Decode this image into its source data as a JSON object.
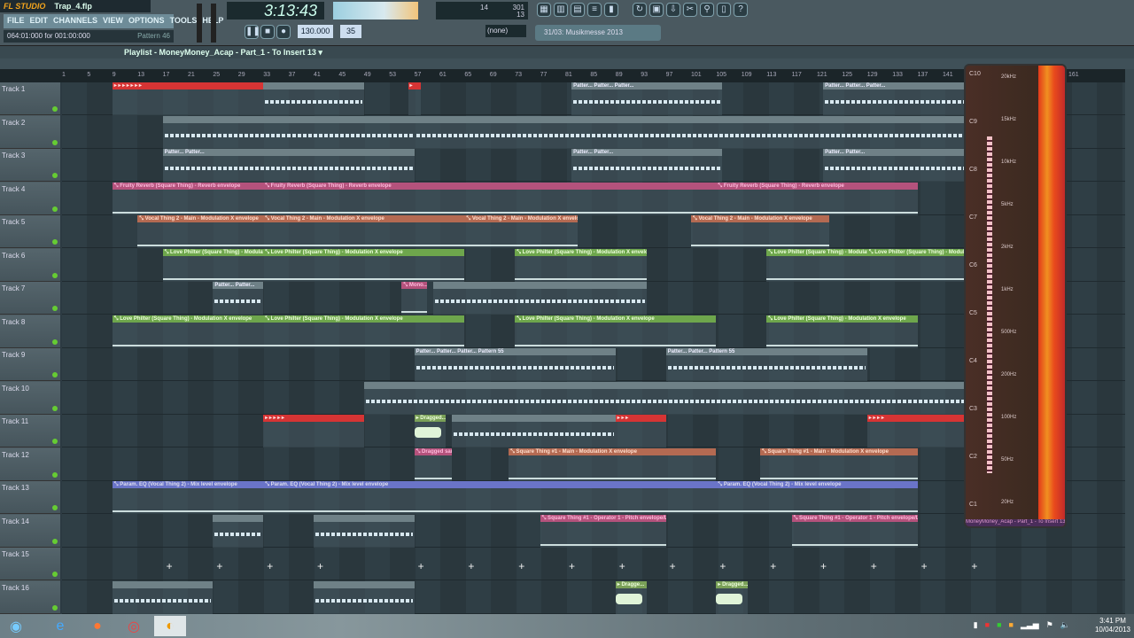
{
  "app": {
    "logo": "FL STUDIO",
    "file": "Trap_4.flp"
  },
  "menu": [
    "FILE",
    "EDIT",
    "CHANNELS",
    "VIEW",
    "OPTIONS",
    "TOOLS",
    "HELP"
  ],
  "hint": {
    "text": "064:01:000 for 001:00:000",
    "pattern": "Pattern 46"
  },
  "transport": {
    "time": "3:13:43",
    "tempo": "130.000",
    "pattern_num": "35",
    "cpu": "14",
    "mem": "301",
    "poly": "13",
    "buttons": [
      "pause",
      "stop",
      "record"
    ]
  },
  "snap": "(none)",
  "news": "31/03: Musikmesse 2013",
  "toolbar_icons": [
    "playlist",
    "step-sequencer",
    "piano-roll",
    "browser",
    "mixer"
  ],
  "toolbar_icons2": [
    "undo",
    "save",
    "export",
    "cut",
    "search",
    "project-info",
    "help"
  ],
  "playlist": {
    "title": "Playlist - MoneyMoney_Acap - Part_1 - To Insert 13 ▾"
  },
  "ruler": {
    "start": 1,
    "step": 4,
    "end": 161
  },
  "tracks": [
    "Track 1",
    "Track 2",
    "Track 3",
    "Track 4",
    "Track 5",
    "Track 6",
    "Track 7",
    "Track 8",
    "Track 9",
    "Track 10",
    "Track 11",
    "Track 12",
    "Track 13",
    "Track 14",
    "Track 15",
    "Track 16"
  ],
  "clips": [
    {
      "t": 0,
      "s": 9,
      "l": 24,
      "type": "red",
      "label": "▸ ▸ ▸ ▸ ▸ ▸ ▸"
    },
    {
      "t": 0,
      "s": 33,
      "l": 16,
      "type": "pat",
      "label": ""
    },
    {
      "t": 0,
      "s": 56,
      "l": 2,
      "type": "red",
      "label": "▸"
    },
    {
      "t": 0,
      "s": 82,
      "l": 24,
      "type": "pat",
      "label": "Patter... Patter... Patter..."
    },
    {
      "t": 0,
      "s": 122,
      "l": 24,
      "type": "pat",
      "label": "Patter... Patter... Patter..."
    },
    {
      "t": 1,
      "s": 17,
      "l": 40,
      "type": "pat",
      "label": ""
    },
    {
      "t": 1,
      "s": 57,
      "l": 88,
      "type": "pat",
      "label": ""
    },
    {
      "t": 2,
      "s": 17,
      "l": 40,
      "type": "pat",
      "label": "Patter... Patter..."
    },
    {
      "t": 2,
      "s": 82,
      "l": 24,
      "type": "pat",
      "label": "Patter... Patter..."
    },
    {
      "t": 2,
      "s": 122,
      "l": 24,
      "type": "pat",
      "label": "Patter... Patter..."
    },
    {
      "t": 3,
      "s": 9,
      "l": 24,
      "type": "pink",
      "label": "⤡ Fruity Reverb (Square Thing) - Reverb envelope"
    },
    {
      "t": 3,
      "s": 33,
      "l": 72,
      "type": "pink",
      "label": "⤡ Fruity Reverb (Square Thing) - Reverb envelope"
    },
    {
      "t": 3,
      "s": 105,
      "l": 32,
      "type": "pink",
      "label": "⤡ Fruity Reverb (Square Thing) - Reverb envelope"
    },
    {
      "t": 4,
      "s": 13,
      "l": 20,
      "type": "orange",
      "label": "⤡ Vocal Thing 2 - Main - Modulation X envelope"
    },
    {
      "t": 4,
      "s": 33,
      "l": 32,
      "type": "orange",
      "label": "⤡ Vocal Thing 2 - Main - Modulation X envelope"
    },
    {
      "t": 4,
      "s": 65,
      "l": 18,
      "type": "orange",
      "label": "⤡ Vocal Thing 2 - Main - Modulation X envelope"
    },
    {
      "t": 4,
      "s": 101,
      "l": 22,
      "type": "orange",
      "label": "⤡ Vocal Thing 2 - Main - Modulation X envelope"
    },
    {
      "t": 5,
      "s": 17,
      "l": 16,
      "type": "green",
      "label": "⤡ Love Philter (Square Thing) - Modulation..."
    },
    {
      "t": 5,
      "s": 33,
      "l": 32,
      "type": "green",
      "label": "⤡ Love Philter (Square Thing) - Modulation X envelope"
    },
    {
      "t": 5,
      "s": 73,
      "l": 21,
      "type": "green",
      "label": "⤡ Love Philter (Square Thing) - Modulation X envelope"
    },
    {
      "t": 5,
      "s": 113,
      "l": 16,
      "type": "green",
      "label": "⤡ Love Philter (Square Thing) - Modulation..."
    },
    {
      "t": 5,
      "s": 129,
      "l": 16,
      "type": "green",
      "label": "⤡ Love Philter (Square Thing) - Modulation..."
    },
    {
      "t": 6,
      "s": 25,
      "l": 8,
      "type": "pat",
      "label": "Patter... Patter..."
    },
    {
      "t": 6,
      "s": 55,
      "l": 4,
      "type": "pink",
      "label": "⤡ Mono..."
    },
    {
      "t": 6,
      "s": 60,
      "l": 34,
      "type": "pat",
      "label": ""
    },
    {
      "t": 7,
      "s": 9,
      "l": 24,
      "type": "green",
      "label": "⤡ Love Philter (Square Thing) - Modulation X envelope"
    },
    {
      "t": 7,
      "s": 33,
      "l": 32,
      "type": "green",
      "label": "⤡ Love Philter (Square Thing) - Modulation X envelope"
    },
    {
      "t": 7,
      "s": 73,
      "l": 32,
      "type": "green",
      "label": "⤡ Love Philter (Square Thing) - Modulation X envelope"
    },
    {
      "t": 7,
      "s": 113,
      "l": 24,
      "type": "green",
      "label": "⤡ Love Philter (Square Thing) - Modulation X envelope"
    },
    {
      "t": 8,
      "s": 57,
      "l": 32,
      "type": "pat",
      "label": "Patter... Patter... Patter... Pattern 55"
    },
    {
      "t": 8,
      "s": 97,
      "l": 32,
      "type": "pat",
      "label": "Patter... Patter... Pattern 55"
    },
    {
      "t": 9,
      "s": 49,
      "l": 96,
      "type": "pat",
      "label": ""
    },
    {
      "t": 10,
      "s": 33,
      "l": 16,
      "type": "red",
      "label": "▸ ▸ ▸ ▸ ▸"
    },
    {
      "t": 10,
      "s": 57,
      "l": 5,
      "type": "sample",
      "label": "▸ Dragged..."
    },
    {
      "t": 10,
      "s": 63,
      "l": 26,
      "type": "pat",
      "label": ""
    },
    {
      "t": 10,
      "s": 89,
      "l": 8,
      "type": "red",
      "label": "▸ ▸ ▸"
    },
    {
      "t": 10,
      "s": 129,
      "l": 16,
      "type": "red",
      "label": "▸ ▸ ▸ ▸"
    },
    {
      "t": 11,
      "s": 57,
      "l": 6,
      "type": "pink",
      "label": "⤡ Dragged sam..."
    },
    {
      "t": 11,
      "s": 72,
      "l": 33,
      "type": "orange",
      "label": "⤡ Square Thing #1 - Main - Modulation X envelope"
    },
    {
      "t": 11,
      "s": 112,
      "l": 25,
      "type": "orange",
      "label": "⤡ Square Thing #1 - Main - Modulation X envelope"
    },
    {
      "t": 12,
      "s": 9,
      "l": 24,
      "type": "blue",
      "label": "⤡ Param. EQ (Vocal Thing 2) - Mix level envelope"
    },
    {
      "t": 12,
      "s": 33,
      "l": 72,
      "type": "blue",
      "label": "⤡ Param. EQ (Vocal Thing 2) - Mix level envelope"
    },
    {
      "t": 12,
      "s": 105,
      "l": 32,
      "type": "blue",
      "label": "⤡ Param. EQ (Vocal Thing 2) - Mix level envelope"
    },
    {
      "t": 13,
      "s": 25,
      "l": 8,
      "type": "pat",
      "label": ""
    },
    {
      "t": 13,
      "s": 41,
      "l": 16,
      "type": "pat",
      "label": ""
    },
    {
      "t": 13,
      "s": 77,
      "l": 20,
      "type": "pink",
      "label": "⤡ Square Thing #1 - Operator 1 - Pitch envelope/LFO ..."
    },
    {
      "t": 13,
      "s": 117,
      "l": 20,
      "type": "pink",
      "label": "⤡ Square Thing #1 - Operator 1 - Pitch envelope/LFO ..."
    },
    {
      "t": 15,
      "s": 9,
      "l": 16,
      "type": "pat",
      "label": ""
    },
    {
      "t": 15,
      "s": 41,
      "l": 16,
      "type": "pat",
      "label": ""
    },
    {
      "t": 15,
      "s": 89,
      "l": 5,
      "type": "sample",
      "label": "▸ Dragge..."
    },
    {
      "t": 15,
      "s": 105,
      "l": 5,
      "type": "sample",
      "label": "▸ Dragged..."
    }
  ],
  "track15_markers": [
    17,
    25,
    33,
    41,
    57,
    65,
    73,
    81,
    89,
    97,
    105,
    113,
    121,
    129,
    137,
    145
  ],
  "spectrogram": {
    "notes": [
      "C10",
      "C9",
      "C8",
      "C7",
      "C6",
      "C5",
      "C4",
      "C3",
      "C2",
      "C1"
    ],
    "freqs": [
      "20kHz",
      "15kHz",
      "10kHz",
      "5kHz",
      "2kHz",
      "1kHz",
      "500Hz",
      "200Hz",
      "100Hz",
      "50Hz",
      "20Hz"
    ],
    "caption": "MoneyMoney_Acap - Part_1 - To Insert 13 mixed"
  },
  "taskbar": {
    "apps": [
      "start",
      "internet-explorer",
      "firefox",
      "chrome",
      "fl-studio"
    ],
    "time": "3:41 PM",
    "date": "10/04/2013"
  },
  "colors": {
    "pink": "#b4527c",
    "orange": "#b46a52",
    "green": "#6ea64c",
    "blue": "#6a74c8",
    "red": "#d63434"
  }
}
